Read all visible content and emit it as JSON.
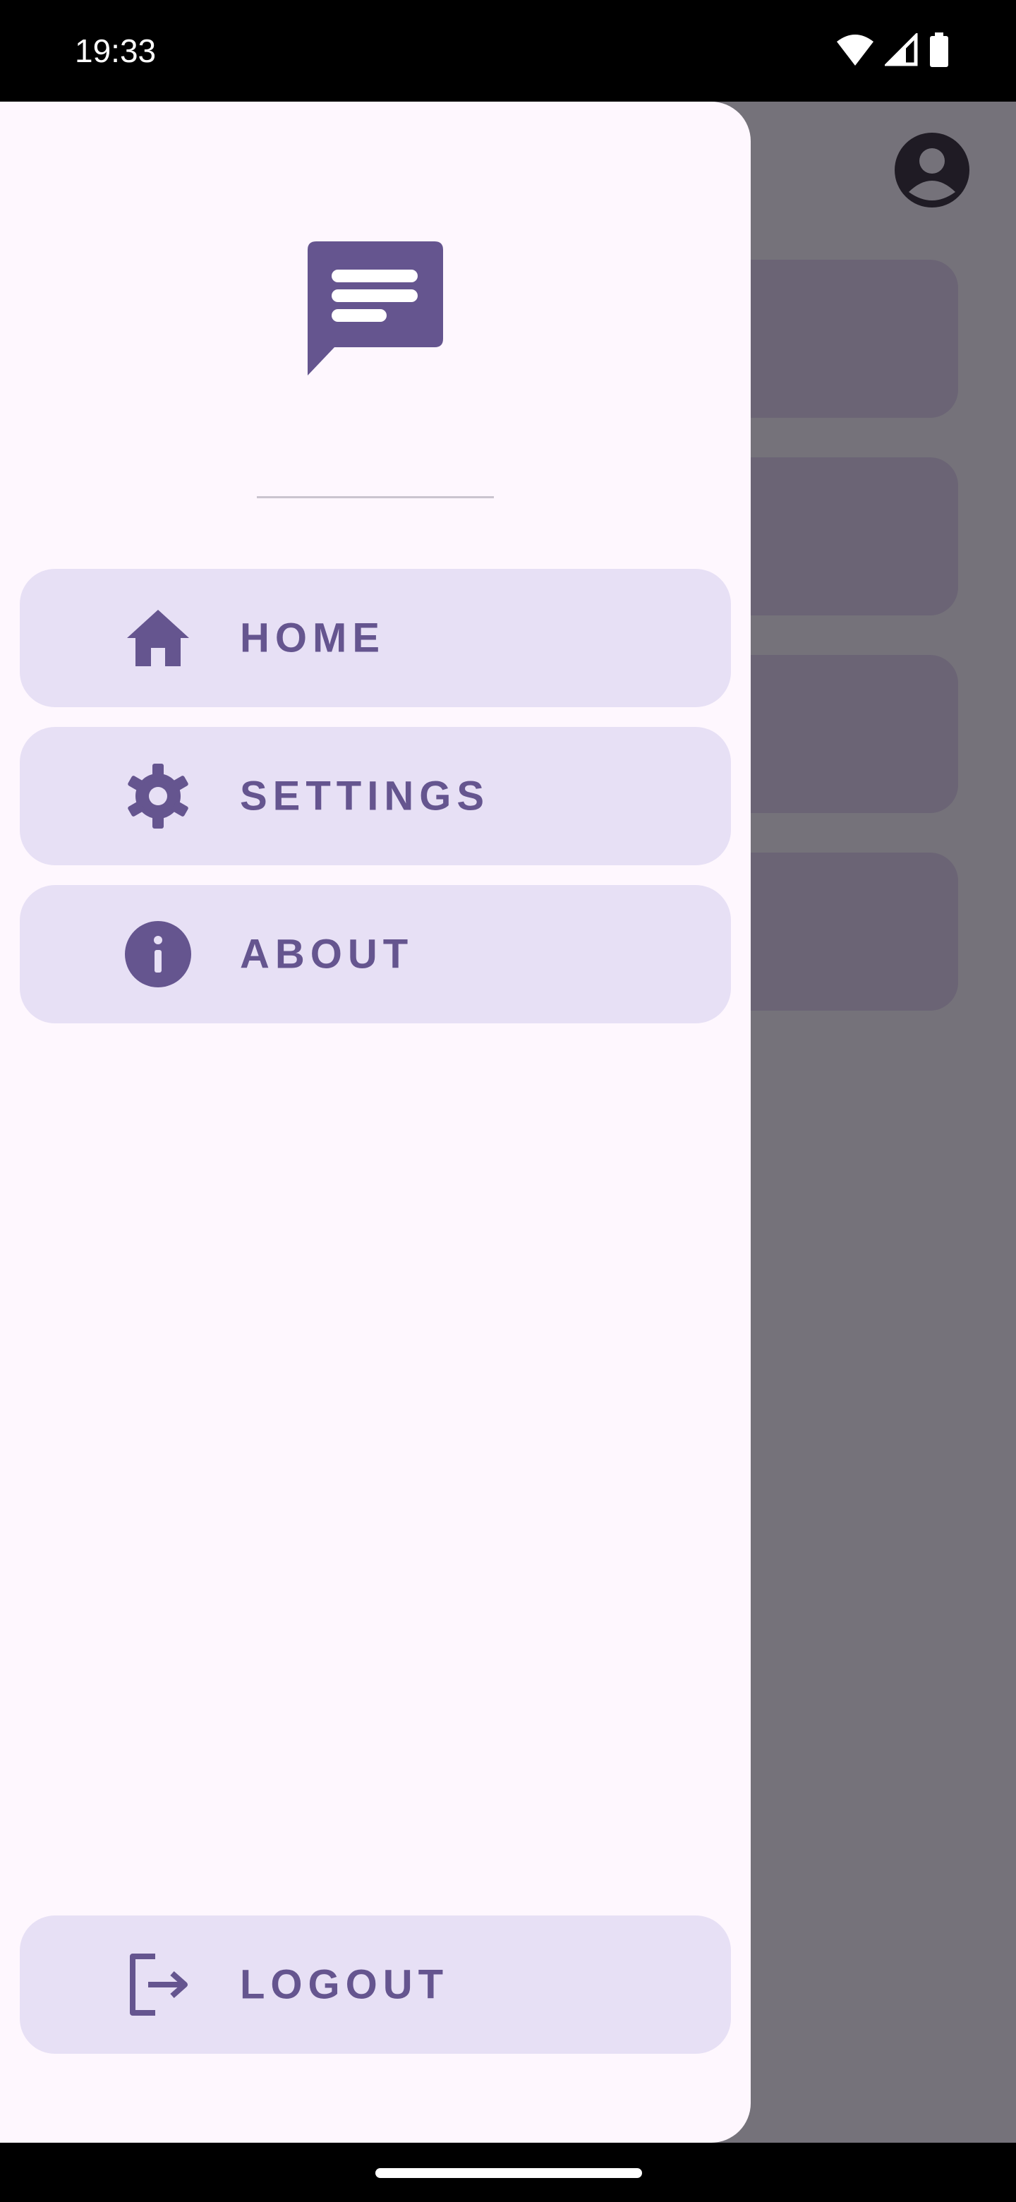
{
  "status_bar": {
    "time": "19:33",
    "icons": [
      "wifi-icon",
      "cellular-signal-icon",
      "battery-icon"
    ]
  },
  "background": {
    "avatar_icon": "account-circle-icon",
    "cards_count_visible": 4
  },
  "drawer": {
    "logo_icon": "chat-bubble-icon",
    "items": [
      {
        "label": "HOME",
        "icon": "home-icon"
      },
      {
        "label": "SETTINGS",
        "icon": "gear-icon"
      },
      {
        "label": "ABOUT",
        "icon": "info-icon"
      }
    ],
    "logout": {
      "label": "LOGOUT",
      "icon": "logout-icon"
    }
  },
  "colors": {
    "accent": "#65558f",
    "item_background": "#e7e0f5",
    "drawer_background": "#fef7fe",
    "scrim": "#75727a"
  }
}
